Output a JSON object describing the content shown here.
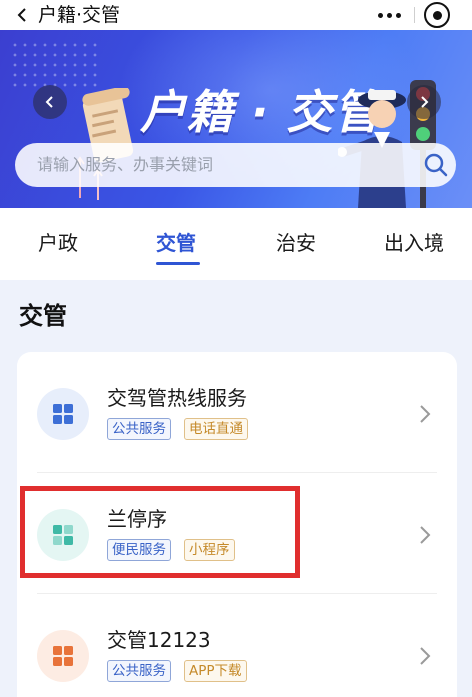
{
  "navbar": {
    "title": "户籍·交管",
    "icons": [
      "back-arrow-icon",
      "more-dots-icon",
      "target-circle-icon"
    ]
  },
  "banner": {
    "title": "户籍 · 交管",
    "search_placeholder": "请输入服务、办事关键词",
    "colors": {
      "gradient_start": "#3b3fd0",
      "gradient_end": "#6b8ff7"
    }
  },
  "tabs": [
    {
      "label": "户政",
      "active": false
    },
    {
      "label": "交管",
      "active": true
    },
    {
      "label": "治安",
      "active": false
    },
    {
      "label": "出入境",
      "active": false
    }
  ],
  "section": {
    "title": "交管",
    "items": [
      {
        "name": "交驾管热线服务",
        "tags": [
          "公共服务",
          "电话直通"
        ],
        "icon_color": "#3d6fd6",
        "icon_bg": "#e7eefb"
      },
      {
        "name": "兰停序",
        "tags": [
          "便民服务",
          "小程序"
        ],
        "icon_color": "#3fb9a6",
        "icon_bg": "#e4f6f3"
      },
      {
        "name": "交管12123",
        "tags": [
          "公共服务",
          "APP下载"
        ],
        "icon_color": "#e8733a",
        "icon_bg": "#fdece3"
      }
    ]
  },
  "colors": {
    "accent": "#2f55d4",
    "highlight": "#e02e2e"
  }
}
